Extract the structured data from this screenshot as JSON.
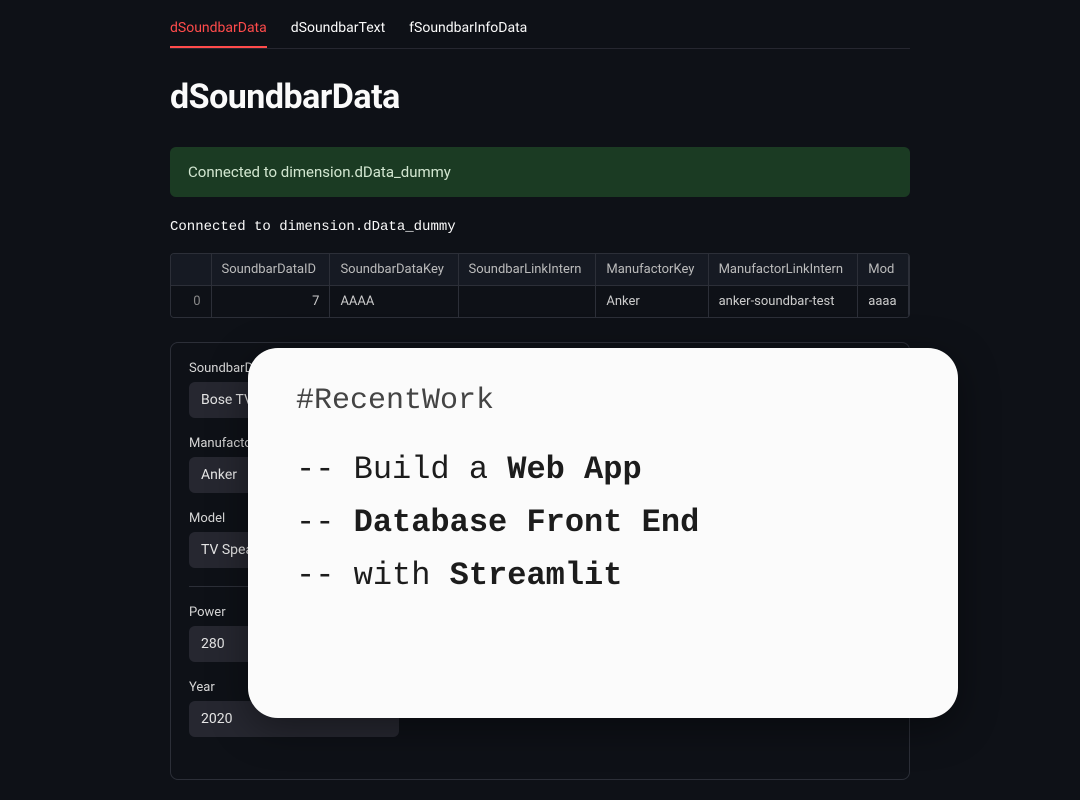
{
  "tabs": [
    {
      "label": "dSoundbarData",
      "active": true
    },
    {
      "label": "dSoundbarText",
      "active": false
    },
    {
      "label": "fSoundbarInfoData",
      "active": false
    }
  ],
  "title": "dSoundbarData",
  "alert": "Connected to dimension.dData_dummy",
  "status_mono": "Connected to dimension.dData_dummy",
  "table": {
    "headers": [
      "",
      "SoundbarDataID",
      "SoundbarDataKey",
      "SoundbarLinkIntern",
      "ManufactorKey",
      "ManufactorLinkIntern",
      "Mod"
    ],
    "rows": [
      {
        "idx": "0",
        "cells": [
          "7",
          "AAAA",
          "",
          "Anker",
          "anker-soundbar-test",
          "aaaa"
        ]
      }
    ]
  },
  "form": {
    "soundbar_label": "SoundbarDa",
    "soundbar_value": "Bose TV",
    "manufactor_label": "Manufactor",
    "manufactor_value": "Anker",
    "model_label": "Model",
    "model_value": "TV Speak",
    "power_label": "Power",
    "power_value": "280",
    "year_label": "Year",
    "year_value": "2020"
  },
  "overlay": {
    "hash": "#RecentWork",
    "line1_prefix": "-- Build a ",
    "line1_bold": "Web App",
    "line2_prefix": "-- ",
    "line2_bold": "Database Front End",
    "line3_prefix": "-- with ",
    "line3_bold": "Streamlit"
  }
}
